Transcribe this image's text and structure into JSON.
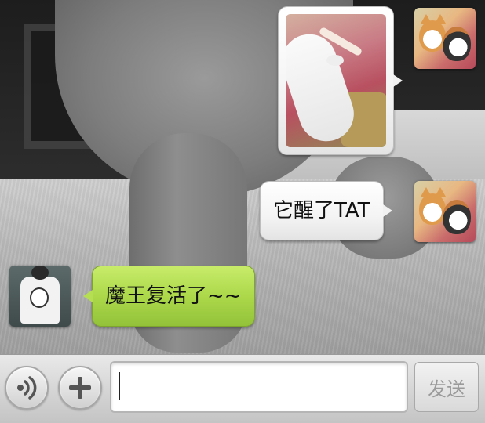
{
  "messages": [
    {
      "sender": "self",
      "type": "image",
      "avatar": "cats-avatar-icon"
    },
    {
      "sender": "self",
      "type": "text",
      "text": "它醒了TAT",
      "avatar": "cats-avatar-icon"
    },
    {
      "sender": "other",
      "type": "text",
      "text": "魔王复活了~~",
      "avatar": "tshirt-avatar-icon"
    }
  ],
  "input_bar": {
    "voice_icon": "voice-icon",
    "plus_icon": "plus-icon",
    "input_value": "",
    "send_label": "发送"
  },
  "colors": {
    "incoming_bubble": "#acd84a",
    "outgoing_bubble": "#f4f4f4",
    "send_text": "#9a9a9a"
  }
}
